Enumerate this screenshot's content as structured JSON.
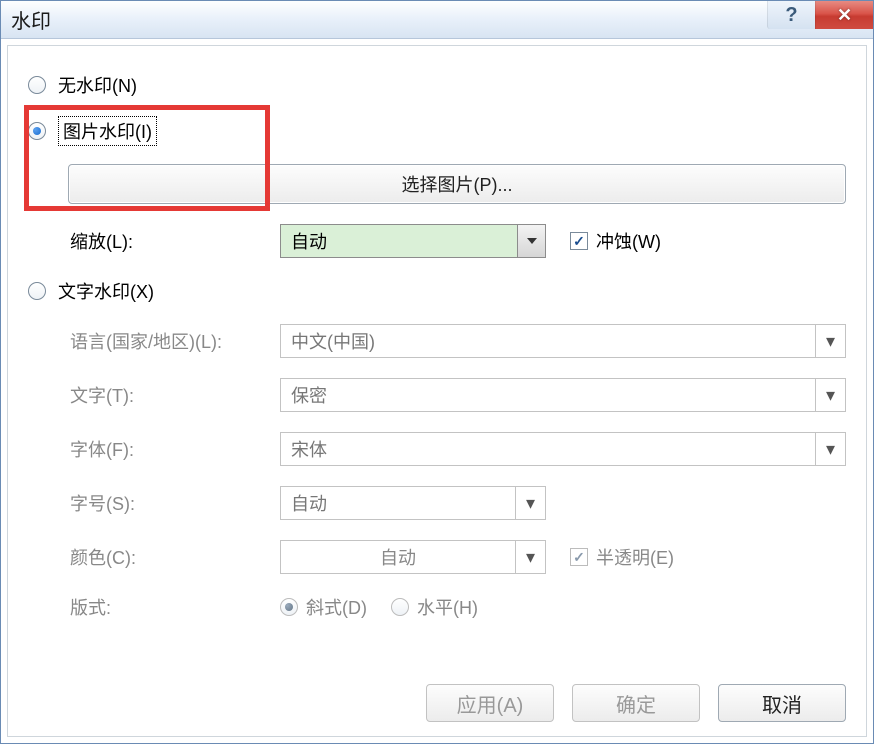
{
  "window": {
    "title": "水印"
  },
  "options": {
    "no_watermark": "无水印(N)",
    "picture_watermark": "图片水印(I)",
    "text_watermark": "文字水印(X)"
  },
  "picture": {
    "select_button": "选择图片(P)...",
    "scale_label": "缩放(L):",
    "scale_value": "自动",
    "washout_label": "冲蚀(W)"
  },
  "text": {
    "language_label": "语言(国家/地区)(L):",
    "language_value": "中文(中国)",
    "text_label": "文字(T):",
    "text_value": "保密",
    "font_label": "字体(F):",
    "font_value": "宋体",
    "size_label": "字号(S):",
    "size_value": "自动",
    "color_label": "颜色(C):",
    "color_value": "自动",
    "semi_label": "半透明(E)",
    "layout_label": "版式:",
    "diagonal": "斜式(D)",
    "horizontal": "水平(H)"
  },
  "footer": {
    "apply": "应用(A)",
    "ok": "确定",
    "cancel": "取消"
  }
}
